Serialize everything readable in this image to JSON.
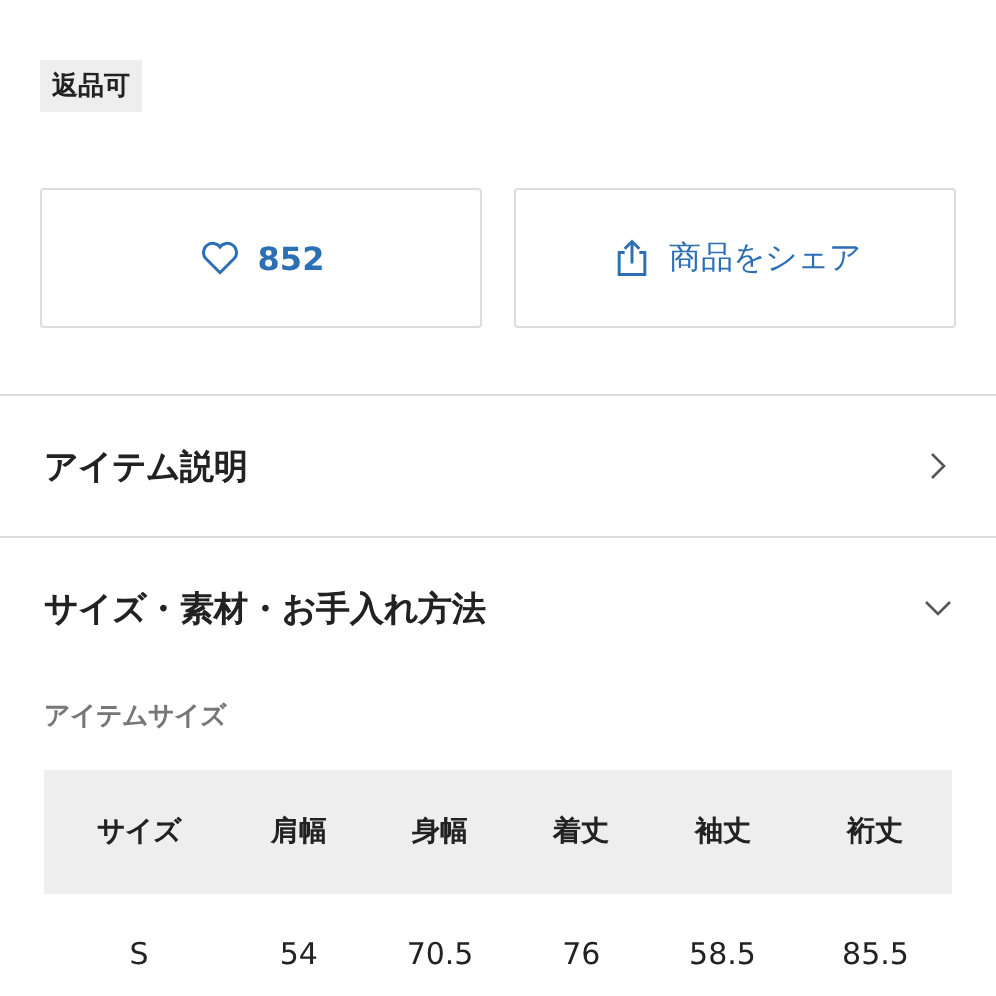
{
  "tags": [
    "返品可"
  ],
  "actions": [
    {
      "kind": "like",
      "label": "852"
    },
    {
      "kind": "share",
      "label": "商品をシェア"
    }
  ],
  "sections": [
    {
      "title": "アイテム説明",
      "expanded": false
    },
    {
      "title": "サイズ・素材・お手入れ方法",
      "expanded": true
    }
  ],
  "size_table": {
    "title": "アイテムサイズ",
    "columns": [
      "サイズ",
      "肩幅",
      "身幅",
      "着丈",
      "袖丈",
      "裄丈"
    ],
    "rows": [
      [
        "S",
        "54",
        "70.5",
        "76",
        "58.5",
        "85.5"
      ]
    ]
  }
}
